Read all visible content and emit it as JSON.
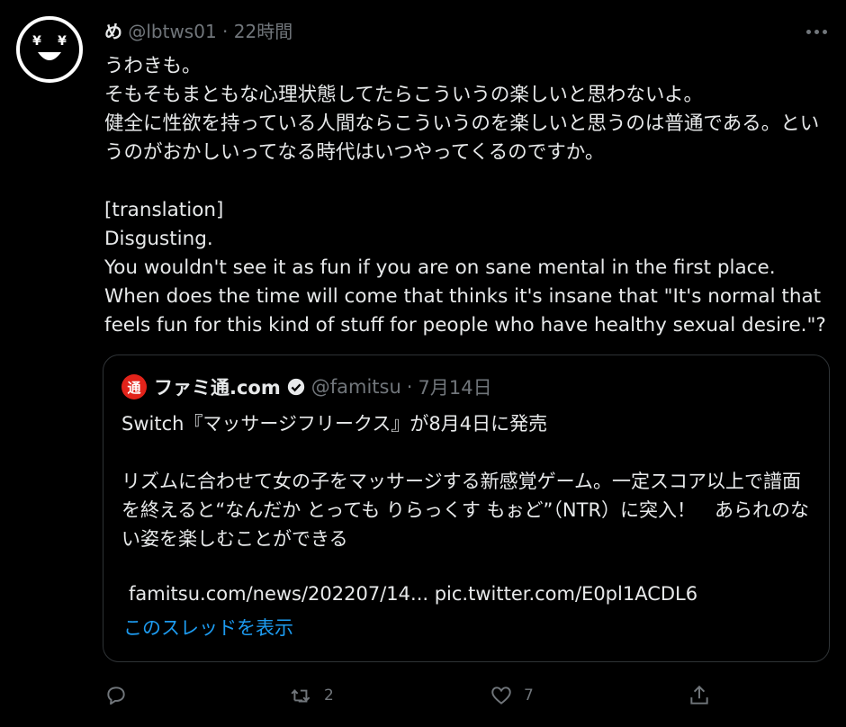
{
  "tweet": {
    "display_name": "め",
    "handle": "@lbtws01",
    "separator": "·",
    "time": "22時間",
    "body": "うわきも。\nそもそもまともな心理状態してたらこういうの楽しいと思わないよ。\n健全に性欲を持っている人間ならこういうのを楽しいと思うのは普通である。というのがおかしいってなる時代はいつやってくるのですか。\n\n[translation]\nDisgusting.\nYou wouldn't see it as fun if you are on sane mental in the first place.\nWhen does the time will come that thinks it's insane that \"It's normal that feels fun for this kind of stuff for people who have healthy sexual desire.\"?",
    "avatar_icon": "yen-eyes-smiley-icon",
    "more_icon": "more-options-icon"
  },
  "quote": {
    "logo_text": "通",
    "display_name": "ファミ通.com",
    "handle": "@famitsu",
    "separator": "·",
    "date": "7月14日",
    "body": "Switch『マッサージフリークス』が8月4日に発売\n\nリズムに合わせて女の子をマッサージする新感覚ゲーム。一定スコア以上で譜面を終えると“なんだか とっても りらっくす もぉど”（NTR）に突入！　あられのない姿を楽しむことができる",
    "link_text": "famitsu.com/news/202207/14... pic.twitter.com/E0pl1ACDL6",
    "show_thread": "このスレッドを表示"
  },
  "actions": {
    "reply_icon": "reply-icon",
    "retweet_icon": "retweet-icon",
    "retweet_count": "2",
    "like_icon": "like-icon",
    "like_count": "7",
    "share_icon": "share-icon"
  },
  "colors": {
    "background": "#000000",
    "text": "#e7e9ea",
    "muted": "#71767b",
    "link": "#1d9bf0",
    "border": "#2f3336",
    "famitsu_red": "#e2231a"
  }
}
